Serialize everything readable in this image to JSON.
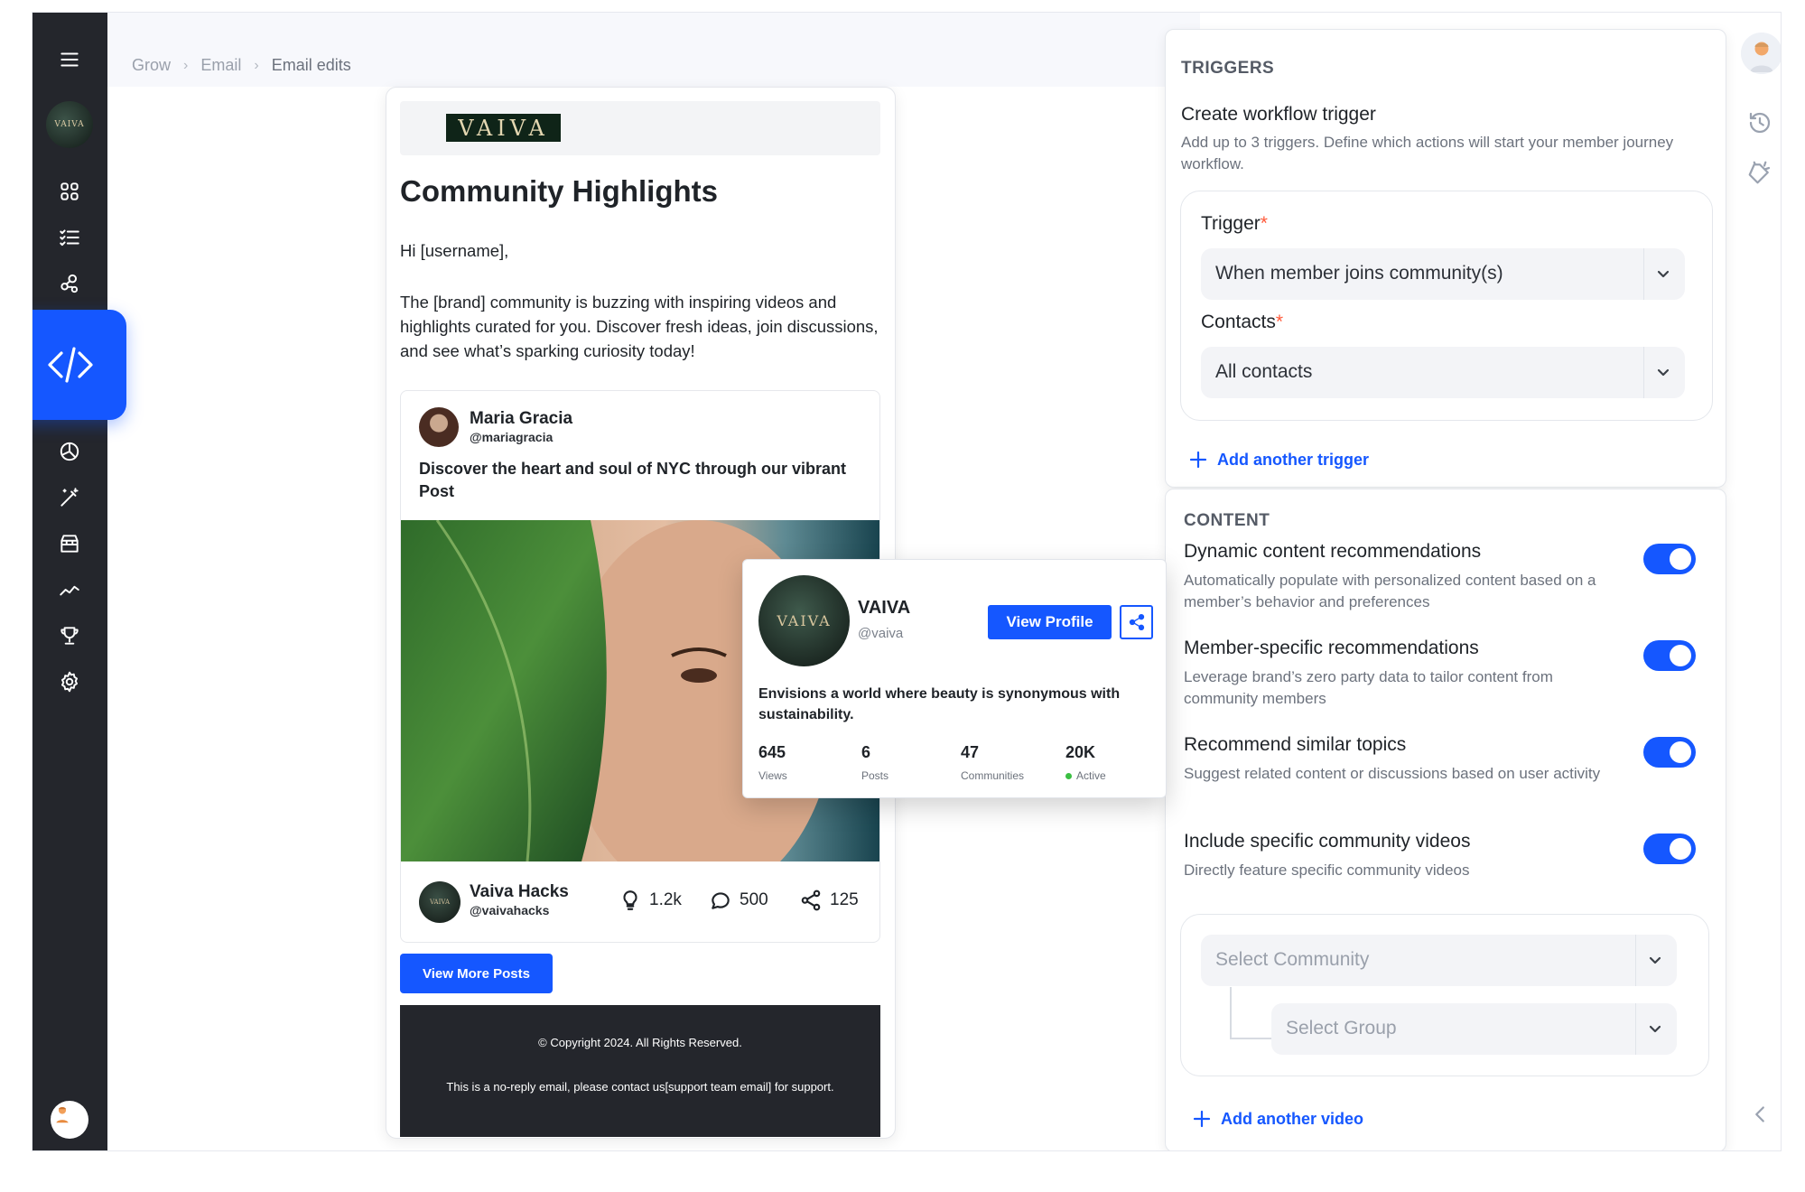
{
  "breadcrumb": {
    "items": [
      "Grow",
      "Email",
      "Email edits"
    ]
  },
  "sidebar": {
    "brand_avatar_text": "VAIVA",
    "icons": [
      "menu-icon",
      "grid-icon",
      "checklist-icon",
      "network-icon",
      "code-icon",
      "chart-pie-icon",
      "magic-wand-icon",
      "store-icon",
      "trend-icon",
      "trophy-icon",
      "gear-icon"
    ]
  },
  "email": {
    "brand_logo": "VAIVA",
    "title": "Community Highlights",
    "greeting": "Hi [username],",
    "intro": "The [brand] community is buzzing with inspiring videos and highlights curated for you. Discover fresh ideas, join discussions, and see what’s sparking curiosity today!",
    "post": {
      "author": "Maria Gracia",
      "handle": "@mariagracia",
      "text": "Discover the heart and soul of NYC through our vibrant Post",
      "footer_author": "Vaiva Hacks",
      "footer_handle": "@vaivahacks",
      "footer_avatar_text": "VAIVA",
      "likes": "1.2k",
      "comments": "500",
      "shares": "125"
    },
    "view_more_label": "View More Posts",
    "copyright": "© Copyright 2024. All Rights Reserved.",
    "noreply": "This is a no-reply email, please contact us[support team email] for support."
  },
  "profile_card": {
    "avatar_text": "VAIVA",
    "name": "VAIVA",
    "handle": "@vaiva",
    "view_profile_label": "View Profile",
    "bio": "Envisions a world where beauty is synonymous with sustainability.",
    "stats": [
      {
        "value": "645",
        "label": "Views"
      },
      {
        "value": "6",
        "label": "Posts"
      },
      {
        "value": "47",
        "label": "Communities"
      },
      {
        "value": "20K",
        "label": "Active"
      }
    ]
  },
  "triggers": {
    "header": "TRIGGERS",
    "title": "Create workflow trigger",
    "subtitle": "Add up to 3 triggers. Define which actions will start your member journey workflow.",
    "trigger_label": "Trigger",
    "trigger_value": "When member joins community(s)",
    "contacts_label": "Contacts",
    "contacts_value": "All contacts",
    "required_mark": "*",
    "add_label": "Add another trigger"
  },
  "content": {
    "header": "CONTENT",
    "options": [
      {
        "title": "Dynamic content recommendations",
        "desc": "Automatically populate with personalized content based on a member’s behavior and preferences",
        "enabled": true
      },
      {
        "title": "Member-specific recommendations",
        "desc": "Leverage brand’s zero party data to tailor content from community members",
        "enabled": true
      },
      {
        "title": "Recommend similar topics",
        "desc": "Suggest related content or discussions based on user activity",
        "enabled": true
      },
      {
        "title": "Include specific community videos",
        "desc": "Directly feature specific community videos",
        "enabled": true
      }
    ],
    "community_placeholder": "Select Community",
    "group_placeholder": "Select Group",
    "add_label": "Add another video"
  },
  "colors": {
    "accent": "#1557ff",
    "rail": "#24262c",
    "required": "#ff5a3a",
    "active_dot": "#3bbf43"
  }
}
